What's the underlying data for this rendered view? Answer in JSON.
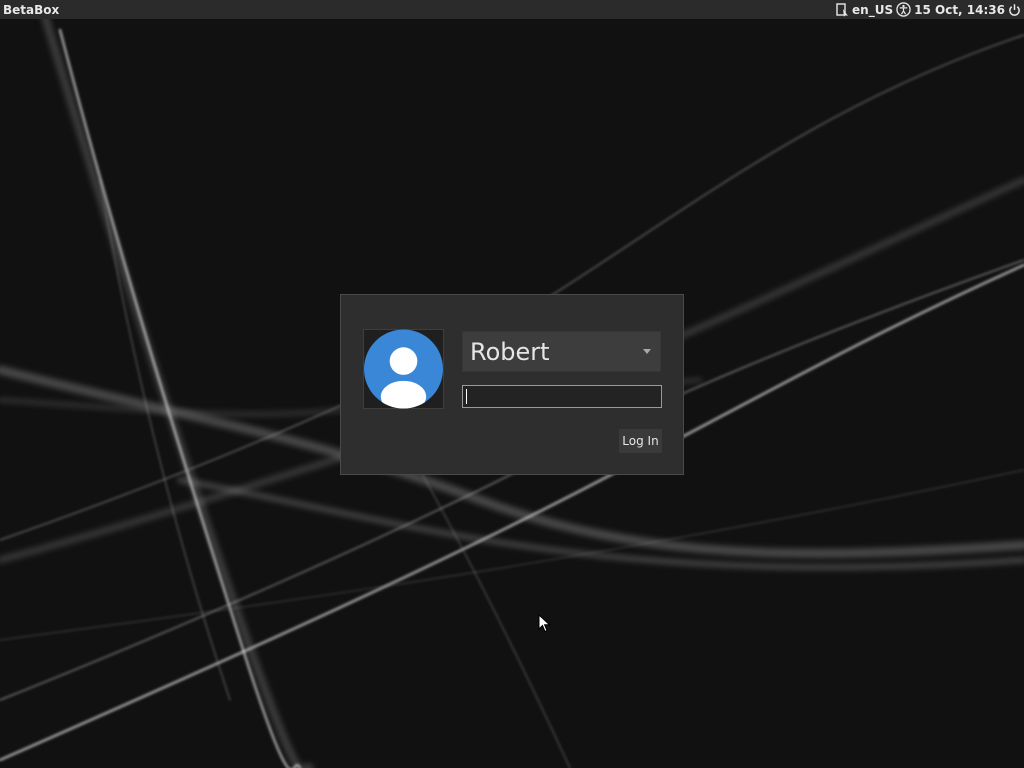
{
  "top_bar": {
    "hostname": "BetaBox",
    "keyboard_layout": "en_US",
    "datetime": "15 Oct, 14:36",
    "icons": [
      "session-indicator-icon",
      "accessibility-icon",
      "power-icon"
    ]
  },
  "login": {
    "selected_user": "Robert",
    "password_value": "",
    "login_button_label": "Log In",
    "avatar_icon": "default-user-avatar-icon",
    "avatar_color": "#3a87d8"
  },
  "colors": {
    "top_bar_bg": "#2b2b2b",
    "panel_bg": "#2e2e2e",
    "desktop_bg": "#111111"
  }
}
